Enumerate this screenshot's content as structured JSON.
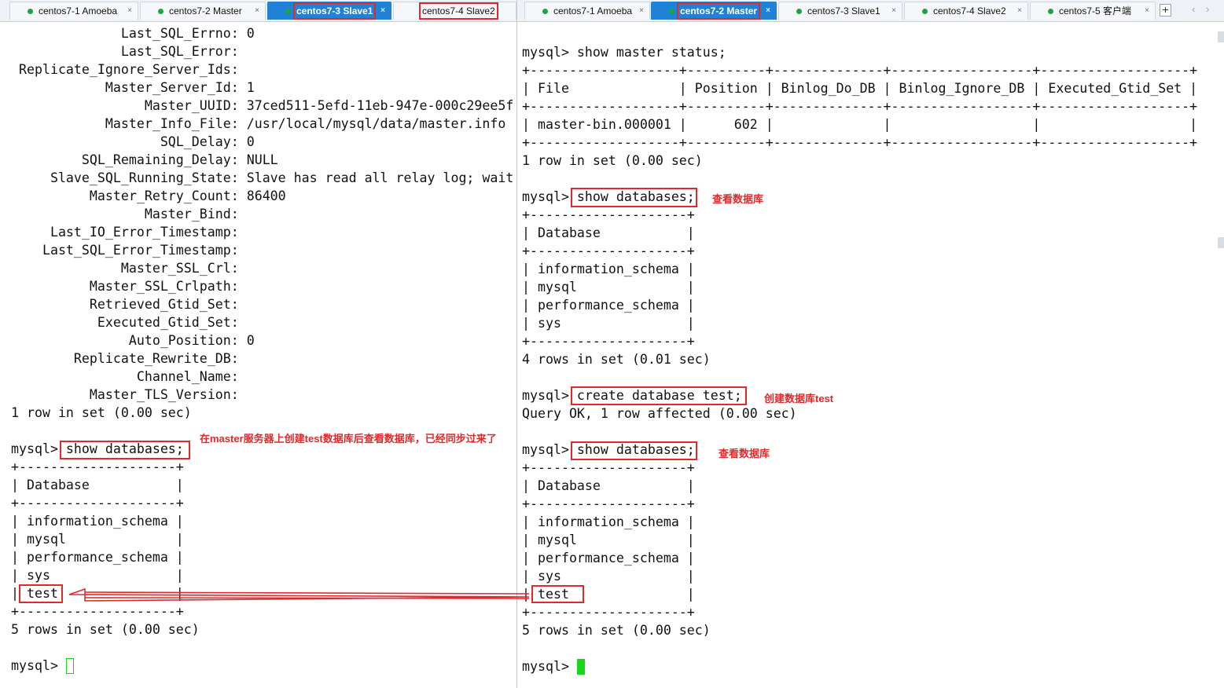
{
  "left_tabs": [
    {
      "label": "centos7-1 Amoeba",
      "active": false
    },
    {
      "label": "centos7-2 Master",
      "active": false
    },
    {
      "label": "centos7-3 Slave1",
      "active": true
    },
    {
      "label": "centos7-4 Slave2",
      "active": false
    }
  ],
  "right_tabs": [
    {
      "label": "centos7-1 Amoeba",
      "active": false
    },
    {
      "label": "centos7-2 Master",
      "active": true
    },
    {
      "label": "centos7-3 Slave1",
      "active": false
    },
    {
      "label": "centos7-4 Slave2",
      "active": false
    },
    {
      "label": "centos7-5 客户端",
      "active": false
    }
  ],
  "tab_controls": {
    "close": "×",
    "new": "+",
    "prev": "‹",
    "next": "›"
  },
  "left_terminal": [
    "              Last_SQL_Errno: 0",
    "              Last_SQL_Error: ",
    " Replicate_Ignore_Server_Ids: ",
    "            Master_Server_Id: 1",
    "                 Master_UUID: 37ced511-5efd-11eb-947e-000c29ee5f",
    "            Master_Info_File: /usr/local/mysql/data/master.info",
    "                   SQL_Delay: 0",
    "         SQL_Remaining_Delay: NULL",
    "     Slave_SQL_Running_State: Slave has read all relay log; wait",
    "          Master_Retry_Count: 86400",
    "                 Master_Bind: ",
    "     Last_IO_Error_Timestamp: ",
    "    Last_SQL_Error_Timestamp: ",
    "              Master_SSL_Crl: ",
    "          Master_SSL_Crlpath: ",
    "          Retrieved_Gtid_Set: ",
    "           Executed_Gtid_Set: ",
    "               Auto_Position: 0",
    "        Replicate_Rewrite_DB: ",
    "                Channel_Name: ",
    "          Master_TLS_Version: ",
    "1 row in set (0.00 sec)",
    "",
    "mysql> show databases;",
    "+--------------------+",
    "| Database           |",
    "+--------------------+",
    "| information_schema |",
    "| mysql              |",
    "| performance_schema |",
    "| sys                |",
    "| test               |",
    "+--------------------+",
    "5 rows in set (0.00 sec)",
    "",
    "mysql> "
  ],
  "right_terminal": [
    "",
    "mysql> show master status;",
    "+-------------------+----------+--------------+------------------+-------------------+",
    "| File              | Position | Binlog_Do_DB | Binlog_Ignore_DB | Executed_Gtid_Set |",
    "+-------------------+----------+--------------+------------------+-------------------+",
    "| master-bin.000001 |      602 |              |                  |                   |",
    "+-------------------+----------+--------------+------------------+-------------------+",
    "1 row in set (0.00 sec)",
    "",
    "mysql> show databases;",
    "+--------------------+",
    "| Database           |",
    "+--------------------+",
    "| information_schema |",
    "| mysql              |",
    "| performance_schema |",
    "| sys                |",
    "+--------------------+",
    "4 rows in set (0.01 sec)",
    "",
    "mysql> create database test;",
    "Query OK, 1 row affected (0.00 sec)",
    "",
    "mysql> show databases;",
    "+--------------------+",
    "| Database           |",
    "+--------------------+",
    "| information_schema |",
    "| mysql              |",
    "| performance_schema |",
    "| sys                |",
    "| test               |",
    "+--------------------+",
    "5 rows in set (0.00 sec)",
    "",
    "mysql> "
  ],
  "annotations": {
    "left_synced": "在master服务器上创建test数据库后查看数据库，已经同步过来了",
    "right_show1": "查看数据库",
    "right_create": "创建数据库test",
    "right_show2": "查看数据库"
  },
  "colors": {
    "annotation": "#e02a2a",
    "active_tab": "#1f82d6",
    "cursor": "#19d619",
    "status_dot": "#1aa83c"
  }
}
